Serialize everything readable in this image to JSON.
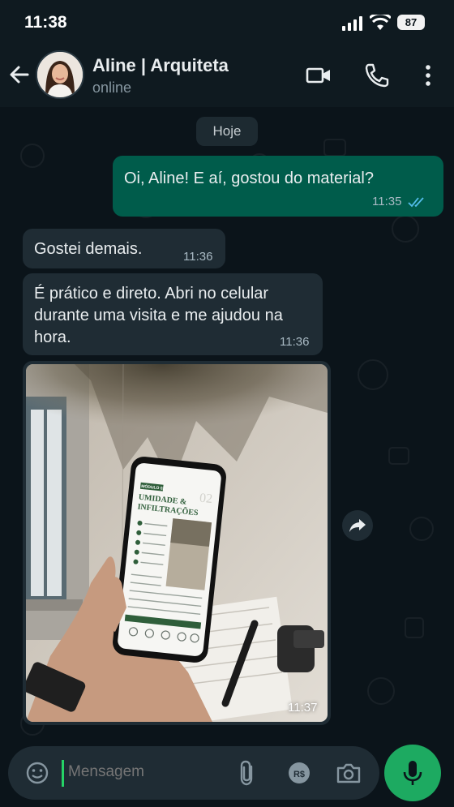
{
  "status_bar": {
    "time": "11:38",
    "battery": "87"
  },
  "header": {
    "contact_name": "Aline | Arquiteta",
    "presence": "online"
  },
  "chat": {
    "date_chip": "Hoje",
    "messages": [
      {
        "direction": "out",
        "text": "Oi, Aline! E aí, gostou do material?",
        "time": "11:35",
        "status": "read"
      },
      {
        "direction": "in",
        "text": "Gostei demais.",
        "time": "11:36"
      },
      {
        "direction": "in",
        "text": "É prático e direto. Abri no celular durante uma visita e me ajudou na hora.",
        "time": "11:36"
      },
      {
        "direction": "in",
        "type": "image",
        "time": "11:37",
        "image_text": {
          "badge": "MÓDULO 02",
          "title_line1": "UMIDADE &",
          "title_line2": "INFILTRAÇÕES",
          "number": "02"
        }
      }
    ]
  },
  "composer": {
    "placeholder": "Mensagem"
  },
  "colors": {
    "incoming_bubble": "#1f2c34",
    "outgoing_bubble": "#005c4b",
    "read_ticks": "#53bdeb",
    "accent": "#1daa61"
  },
  "icons": [
    "back-arrow-icon",
    "video-call-icon",
    "phone-icon",
    "more-vertical-icon",
    "read-ticks-icon",
    "forward-icon",
    "emoji-icon",
    "attach-icon",
    "payment-icon",
    "camera-icon",
    "mic-icon"
  ]
}
